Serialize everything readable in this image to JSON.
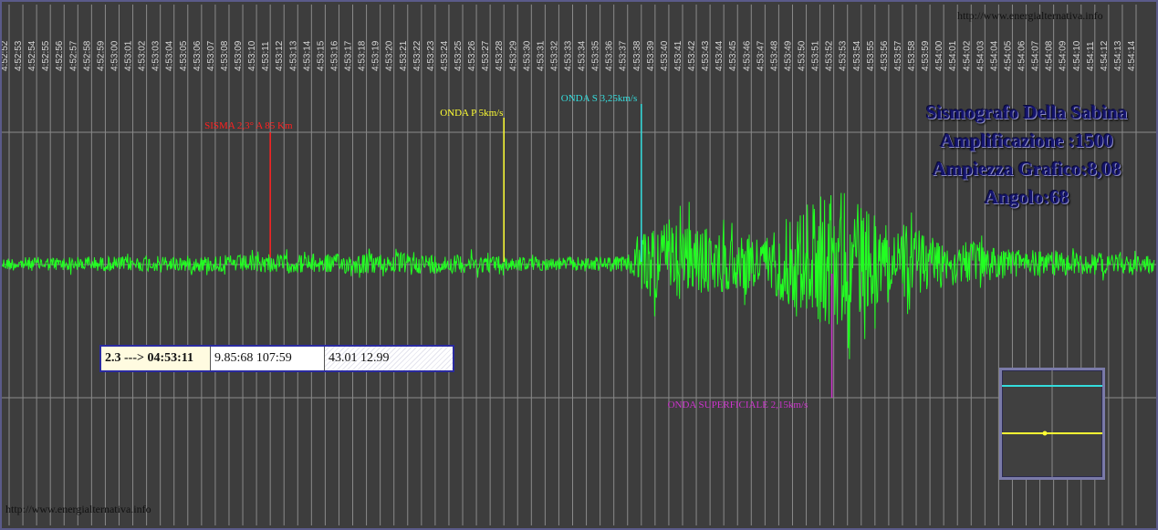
{
  "page": {
    "url_top": "http://www.energialternativa.info",
    "url_bottom": "http://www.energialternativa.info"
  },
  "info": {
    "line1": "Sismografo Della Sabina",
    "line2": "Amplificazione :1500",
    "line3": "Ampiezza Grafico:8,08",
    "line4": "Angolo:68"
  },
  "event": {
    "magnitude_time": "2.3 ---> 04:53:11",
    "coords": "9.85:68 107:59",
    "location": "43.01 12.99"
  },
  "colors": {
    "background": "#3d3d3d",
    "trace": "#22ff22",
    "grid": "#8a8a8a",
    "sisma": "#ff2020",
    "onda_p": "#ffff33",
    "onda_s": "#33dddd",
    "onda_superficiale": "#cc33cc",
    "title": "#14146e"
  },
  "chart_data": {
    "type": "line",
    "title": "",
    "xlabel": "",
    "ylabel": "",
    "grid": true,
    "x_ticks": [
      "4:52:52",
      "4:52:53",
      "4:52:54",
      "4:52:55",
      "4:52:56",
      "4:52:57",
      "4:52:58",
      "4:52:59",
      "4:53:00",
      "4:53:01",
      "4:53:02",
      "4:53:03",
      "4:53:04",
      "4:53:05",
      "4:53:06",
      "4:53:07",
      "4:53:08",
      "4:53:09",
      "4:53:10",
      "4:53:11",
      "4:53:12",
      "4:53:13",
      "4:53:14",
      "4:53:15",
      "4:53:16",
      "4:53:17",
      "4:53:18",
      "4:53:19",
      "4:53:20",
      "4:53:21",
      "4:53:22",
      "4:53:23",
      "4:53:24",
      "4:53:25",
      "4:53:26",
      "4:53:27",
      "4:53:28",
      "4:53:29",
      "4:53:30",
      "4:53:31",
      "4:53:32",
      "4:53:33",
      "4:53:34",
      "4:53:35",
      "4:53:36",
      "4:53:37",
      "4:53:38",
      "4:53:39",
      "4:53:40",
      "4:53:41",
      "4:53:42",
      "4:53:43",
      "4:53:44",
      "4:53:45",
      "4:53:46",
      "4:53:47",
      "4:53:48",
      "4:53:49",
      "4:53:50",
      "4:53:51",
      "4:53:52",
      "4:53:53",
      "4:53:54",
      "4:53:55",
      "4:53:56",
      "4:53:57",
      "4:53:58",
      "4:53:59",
      "4:54:00",
      "4:54:01",
      "4:54:02",
      "4:54:03",
      "4:54:04",
      "4:54:05",
      "4:54:06",
      "4:54:07",
      "4:54:08",
      "4:54:09",
      "4:54:10",
      "4:54:11",
      "4:54:12",
      "4:54:13",
      "4:54:14"
    ],
    "xlim": [
      "4:52:52",
      "4:54:14"
    ],
    "series": [
      {
        "color": "#22ff22",
        "envelope": [
          {
            "x": "4:52:52",
            "amp": 0.09
          },
          {
            "x": "4:53:01",
            "amp": 0.1
          },
          {
            "x": "4:53:11",
            "amp": 0.12
          },
          {
            "x": "4:53:18",
            "amp": 0.14
          },
          {
            "x": "4:53:26",
            "amp": 0.12
          },
          {
            "x": "4:53:31",
            "amp": 0.09
          },
          {
            "x": "4:53:37",
            "amp": 0.1
          },
          {
            "x": "4:53:38",
            "amp": 0.45
          },
          {
            "x": "4:53:40",
            "amp": 0.55
          },
          {
            "x": "4:53:44",
            "amp": 0.4
          },
          {
            "x": "4:53:47",
            "amp": 0.35
          },
          {
            "x": "4:53:49",
            "amp": 0.65
          },
          {
            "x": "4:53:52",
            "amp": 1.0
          },
          {
            "x": "4:53:55",
            "amp": 0.6
          },
          {
            "x": "4:53:58",
            "amp": 0.45
          },
          {
            "x": "4:54:01",
            "amp": 0.3
          },
          {
            "x": "4:54:05",
            "amp": 0.2
          },
          {
            "x": "4:54:14",
            "amp": 0.12
          }
        ]
      }
    ],
    "annotations": [
      {
        "label": "SISMA 2,3° A 85 Km",
        "x": "4:53:11",
        "color": "#ff2020"
      },
      {
        "label": "ONDA P 5km/s",
        "x": "4:53:28",
        "color": "#ffff33"
      },
      {
        "label": "ONDA S 3,25km/s",
        "x": "4:53:38",
        "color": "#33dddd"
      },
      {
        "label": "ONDA SUPERFICIALE 2,15km/s",
        "x": "4:53:51",
        "color": "#cc33cc"
      }
    ]
  }
}
